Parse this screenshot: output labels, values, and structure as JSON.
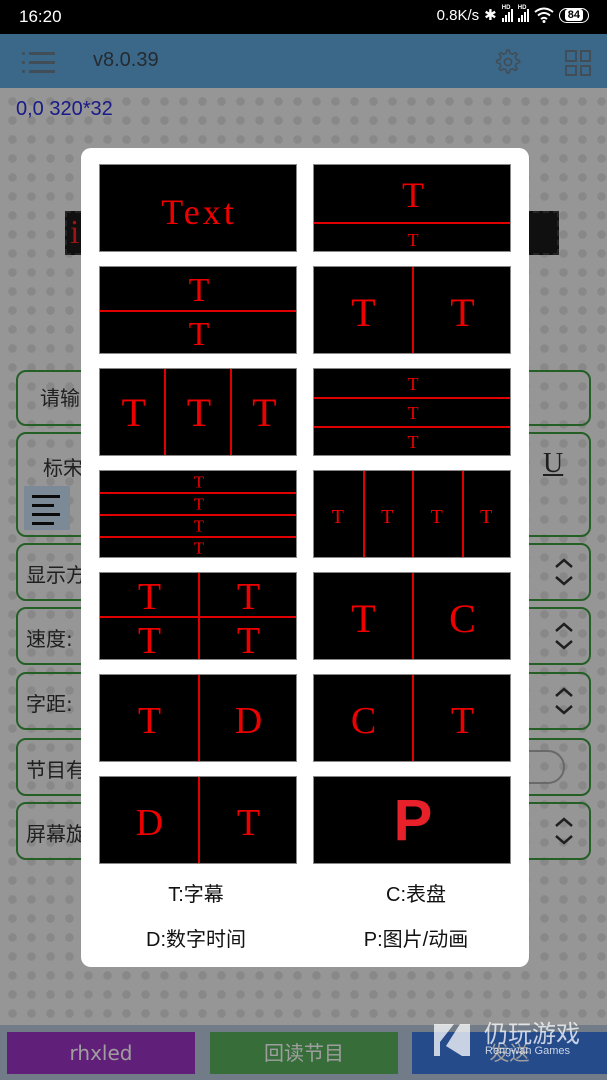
{
  "status_bar": {
    "time": "16:20",
    "net_speed": "0.8K/s",
    "battery": "84",
    "icons": [
      "bluetooth-icon",
      "signal-hd-icon",
      "signal-hd-icon",
      "wifi-icon",
      "battery-icon"
    ]
  },
  "app_bar": {
    "version": "v8.0.39",
    "icons": [
      "menu-icon",
      "gear-icon",
      "layout-grid-icon"
    ]
  },
  "main": {
    "coords": "0,0 320*32",
    "preview_text": "i",
    "fields": [
      {
        "label": "请输",
        "control": "text"
      },
      {
        "label": "标宋",
        "control": "font"
      },
      {
        "label": "显示方",
        "control": "stepper"
      },
      {
        "label": "速度:",
        "control": "stepper"
      },
      {
        "label": "字距:",
        "control": "stepper"
      },
      {
        "label": "节目有",
        "control": "toggle"
      },
      {
        "label": "屏幕旋",
        "control": "stepper"
      }
    ],
    "underline_glyph": "U"
  },
  "bottom_buttons": [
    {
      "label": "rhxled",
      "color": "#9b35c4"
    },
    {
      "label": "回读节目",
      "color": "#57b05c"
    },
    {
      "label": "发送",
      "color": "#3d7ae0"
    }
  ],
  "dialog": {
    "layouts": [
      {
        "id": "text",
        "glyphs": [
          "Text"
        ]
      },
      {
        "id": "t-over-small-t",
        "glyphs": [
          "T",
          "T"
        ]
      },
      {
        "id": "t-over-t",
        "glyphs": [
          "T",
          "T"
        ]
      },
      {
        "id": "t-beside-t",
        "glyphs": [
          "T",
          "T"
        ]
      },
      {
        "id": "three-columns",
        "glyphs": [
          "T",
          "T",
          "T"
        ]
      },
      {
        "id": "three-rows",
        "glyphs": [
          "T",
          "T",
          "T"
        ]
      },
      {
        "id": "four-rows",
        "glyphs": [
          "T",
          "T",
          "T",
          "T"
        ]
      },
      {
        "id": "four-columns",
        "glyphs": [
          "T",
          "T",
          "T",
          "T"
        ]
      },
      {
        "id": "two-by-two",
        "glyphs": [
          "T",
          "T",
          "T",
          "T"
        ]
      },
      {
        "id": "text-clock",
        "glyphs": [
          "T",
          "C"
        ]
      },
      {
        "id": "text-digital",
        "glyphs": [
          "T",
          "D"
        ]
      },
      {
        "id": "clock-text",
        "glyphs": [
          "C",
          "T"
        ]
      },
      {
        "id": "digital-text",
        "glyphs": [
          "D",
          "T"
        ]
      },
      {
        "id": "picture",
        "glyphs": [
          "P"
        ]
      }
    ],
    "legend": [
      "T:字幕",
      "C:表盘",
      "D:数字时间",
      "P:图片/动画"
    ]
  },
  "watermark": {
    "cn": "仍玩游戏",
    "en": "Rengwan Games"
  }
}
